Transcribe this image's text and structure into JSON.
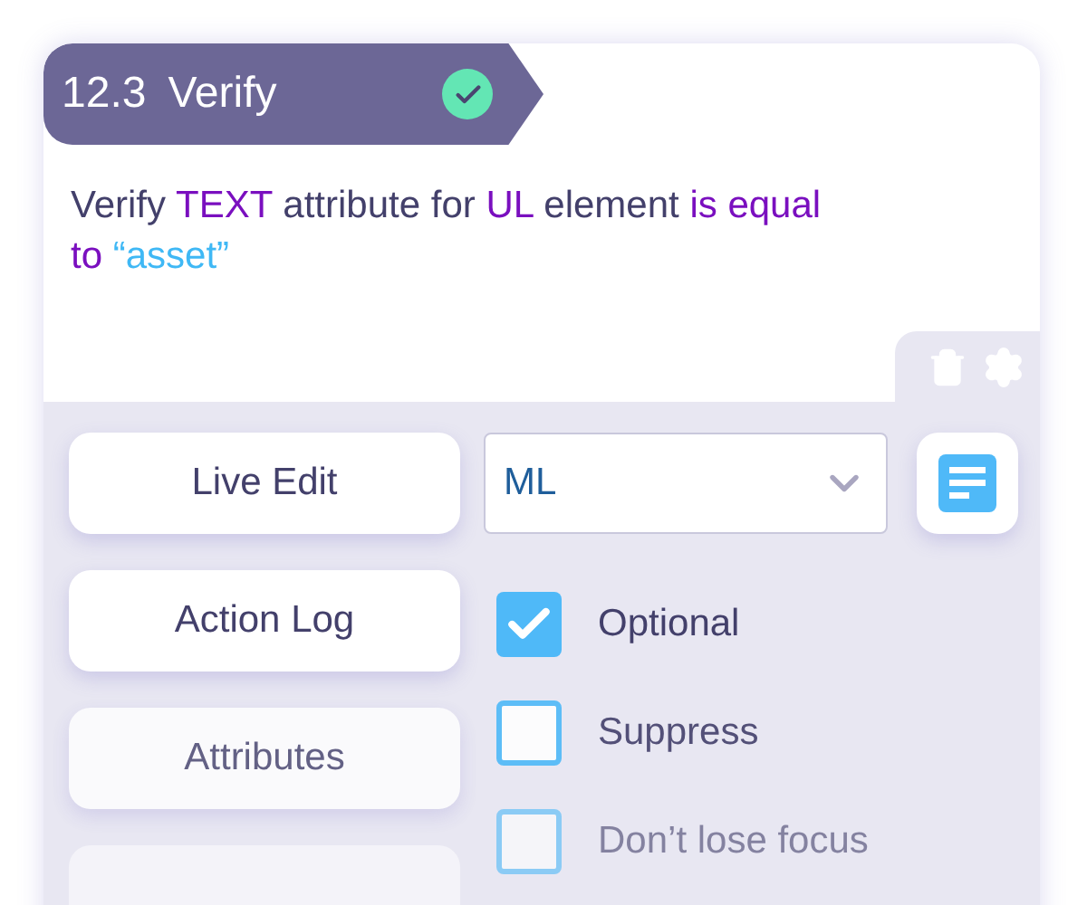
{
  "step": {
    "number": "12.3",
    "title": "Verify",
    "passed": true
  },
  "description": [
    {
      "text": "Verify",
      "kind": "plain"
    },
    {
      "text": "TEXT",
      "kind": "keyword"
    },
    {
      "text": "attribute for",
      "kind": "plain"
    },
    {
      "text": "UL",
      "kind": "keyword"
    },
    {
      "text": "element",
      "kind": "plain"
    },
    {
      "text": "is equal to",
      "kind": "keyword"
    },
    {
      "text": "“asset”",
      "kind": "value"
    }
  ],
  "buttons": [
    {
      "label": "Live Edit"
    },
    {
      "label": "Action Log"
    },
    {
      "label": "Attributes"
    }
  ],
  "dropdown": {
    "value": "ML"
  },
  "options": [
    {
      "label": "Optional",
      "checked": true
    },
    {
      "label": "Suppress",
      "checked": false
    },
    {
      "label": "Don’t lose focus",
      "checked": false
    }
  ]
}
